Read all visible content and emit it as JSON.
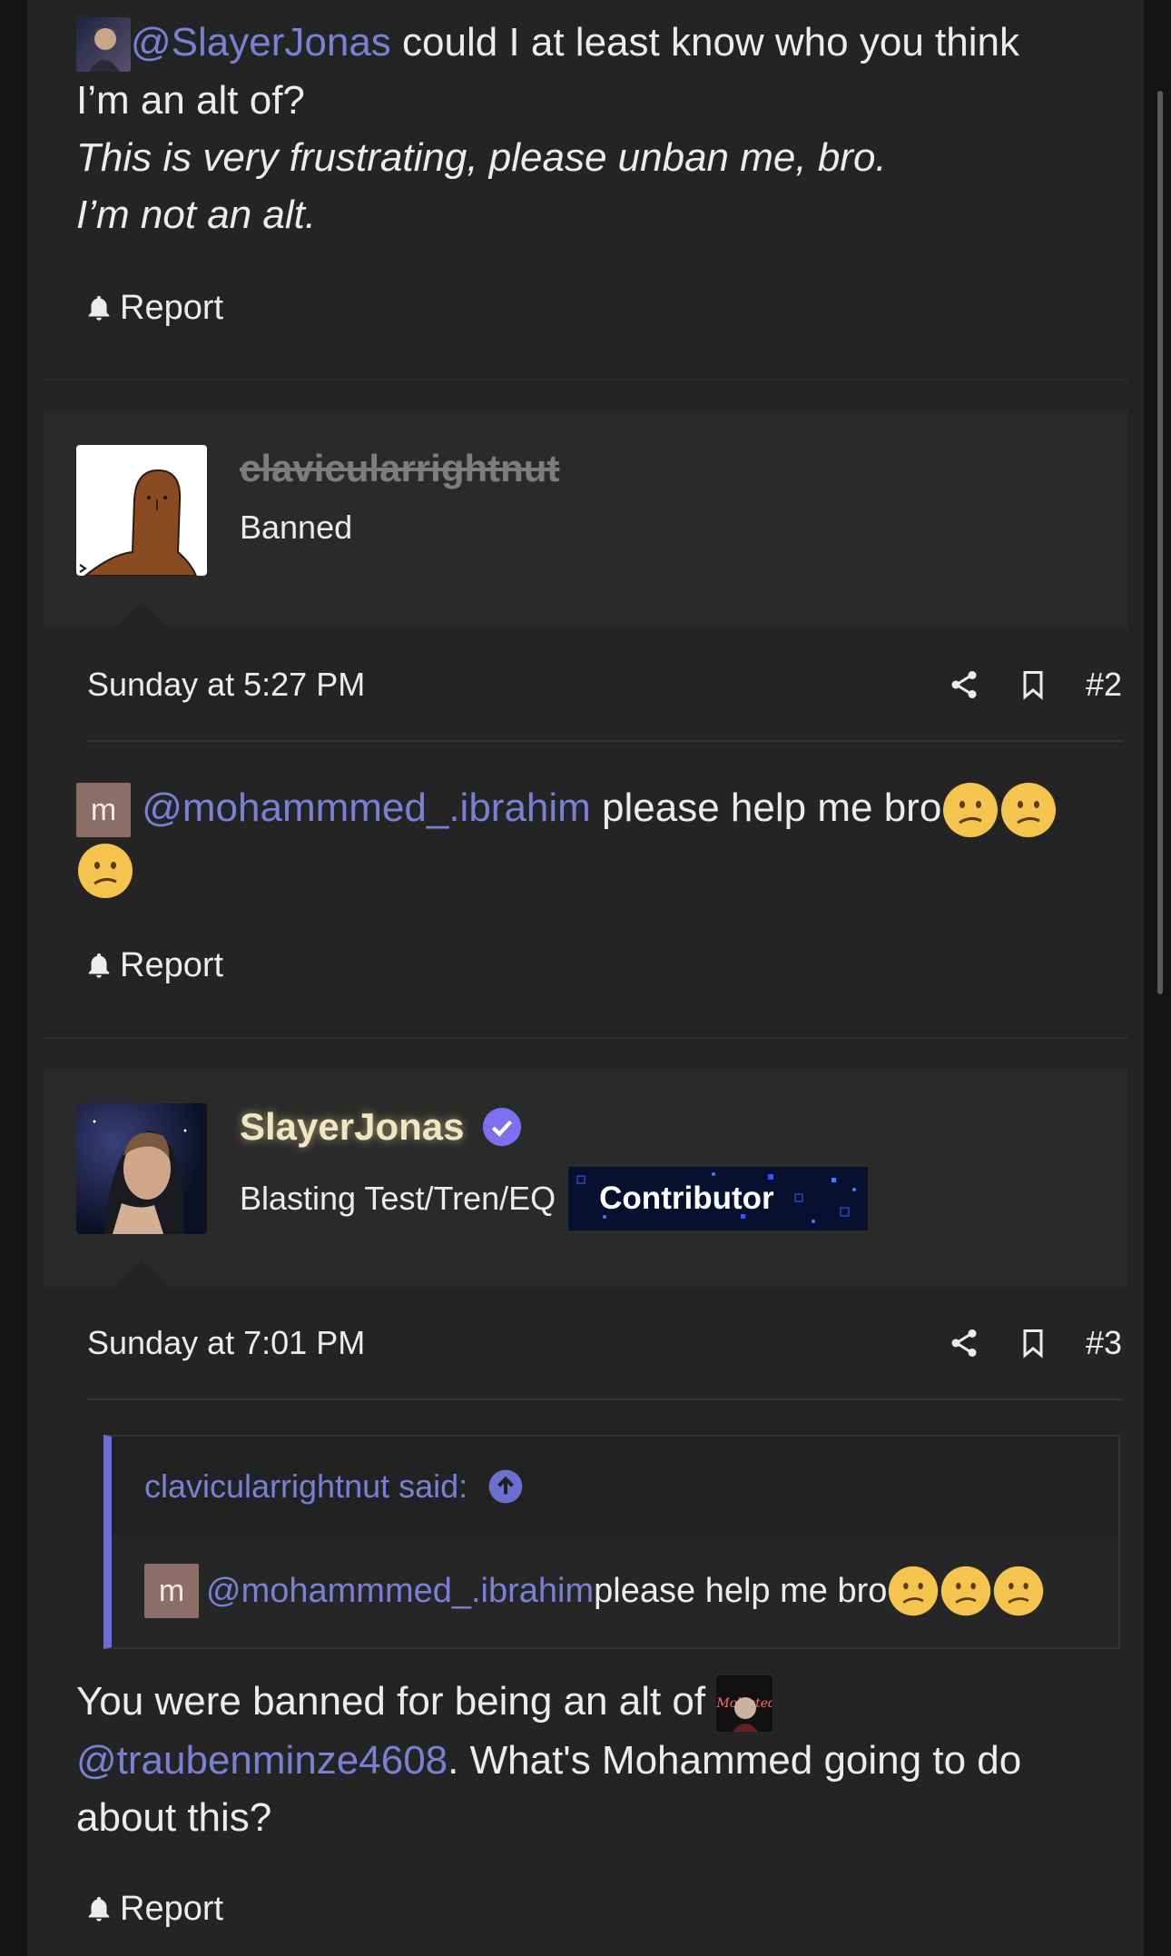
{
  "post1": {
    "mention": "@SlayerJonas",
    "line1_rest": " could I at least know who you think",
    "line2": "I’m an alt of?",
    "line3": "This is very frustrating, please unban me, bro.",
    "line4": "I’m not an alt.",
    "report_label": "Report"
  },
  "post2": {
    "username": "clavicularrightnut",
    "user_title": "Banned",
    "date": "Sunday at 5:27 PM",
    "post_number": "#2",
    "avatar_letter": "m",
    "mention": "@mohammmed_.ibrahim",
    "text": " please help me bro",
    "report_label": "Report"
  },
  "post3": {
    "username": "SlayerJonas",
    "user_title": "Blasting Test/Tren/EQ",
    "badge": "Contributor",
    "date": "Sunday at 7:01 PM",
    "post_number": "#3",
    "quote": {
      "author": "clavicularrightnut said:",
      "avatar_letter": "m",
      "mention": "@mohammmed_.ibrahim",
      "text": " please help me bro"
    },
    "body_pre": "You were banned for being an alt of ",
    "inline_avatar_text": "Molested",
    "body_mention": "@traubenminze4608",
    "body_post1": ". What's Mohammed going to do",
    "body_post2": "about this?",
    "report_label": "Report"
  },
  "colors": {
    "mention": "#7b7fd6",
    "background": "#242424",
    "quote_bar": "#6b6fd0",
    "verified": "#7c6ff0"
  }
}
